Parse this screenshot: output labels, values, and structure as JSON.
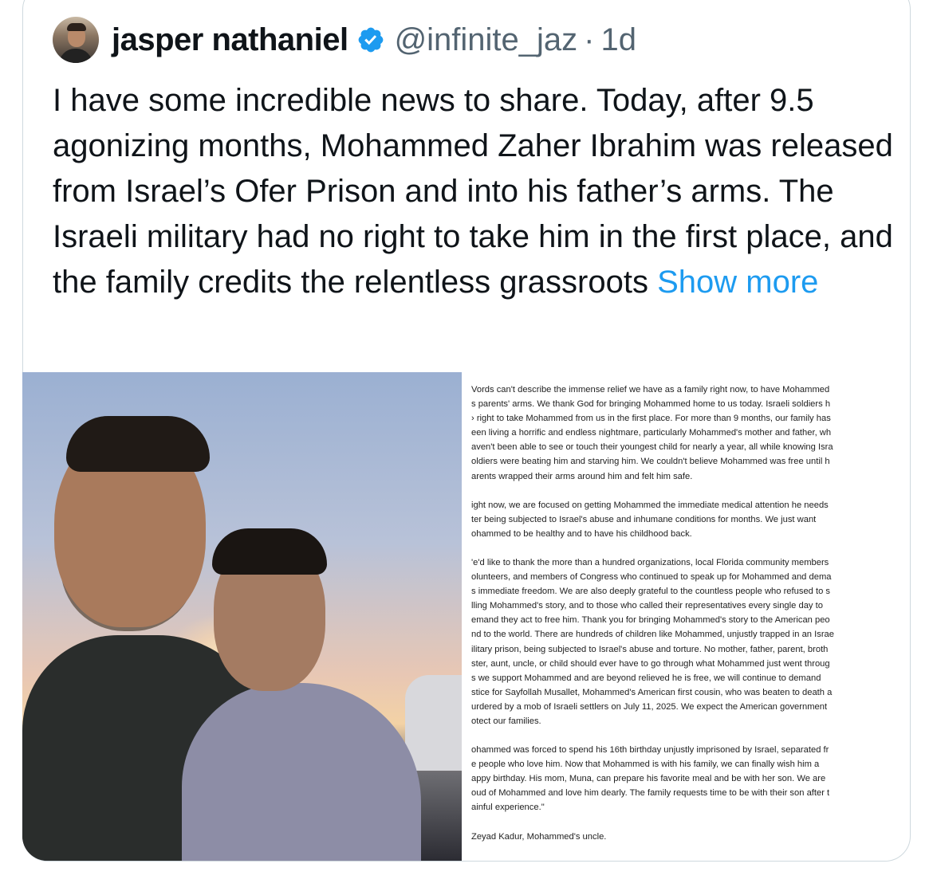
{
  "tweet": {
    "display_name": "jasper nathaniel",
    "handle": "@infinite_jaz",
    "separator": "·",
    "time": "1d",
    "text": "I have some incredible news to share. Today, after 9.5 agonizing months, Mohammed Zaher Ibrahim was released from Israel’s Ofer Prison and into his father’s arms. The Israeli military had no right to take him in the first place, and the family credits the relentless grassroots ",
    "show_more": "Show more"
  },
  "colors": {
    "accent": "#1d9bf0",
    "text": "#0f1419",
    "secondary": "#536471",
    "border": "#cfd9de"
  },
  "icons": {
    "verified": "verified-badge-icon"
  },
  "letter": {
    "paragraphs": [
      [
        "Vords can't describe the immense relief we have as a family right now, to have Mohammed",
        "s parents' arms. We thank God for bringing Mohammed home to us today. Israeli soldiers h",
        "› right to take Mohammed from us in the first place. For more than 9 months, our family has",
        "een living a horrific and endless nightmare, particularly Mohammed's mother and father, wh",
        "aven't been able to see or touch their youngest child for nearly a year, all while knowing Isra",
        "oldiers were beating him and starving him.  We couldn't believe Mohammed was free until h",
        "arents wrapped their arms around him and felt him safe."
      ],
      [
        "ight now, we are focused on getting Mohammed the immediate medical attention he needs",
        "ter being subjected to Israel's abuse and inhumane conditions for months. We just want",
        "ohammed to be healthy and to have his childhood back."
      ],
      [
        "'e'd like to thank the more than a hundred organizations, local Florida community members",
        "olunteers, and members of Congress who continued to speak up for Mohammed and dema",
        "s immediate freedom. We are also deeply grateful to the countless people who refused to s",
        "lling Mohammed's story, and to those who called their representatives every single day to",
        "emand they act to free him. Thank you for bringing Mohammed's story to the American peo",
        "nd to the world. There are hundreds of children like Mohammed, unjustly trapped in an Israe",
        "ilitary prison, being subjected to Israel's abuse and torture. No mother, father, parent, broth",
        "ster, aunt, uncle, or child should ever have to go through what Mohammed just went throug",
        "s we support Mohammed and are beyond relieved he is free, we will continue to demand",
        "stice for Sayfollah Musallet, Mohammed's American first cousin, who was beaten to death a",
        "urdered by a mob of Israeli settlers on July 11, 2025. We expect the American government",
        "otect our families."
      ],
      [
        "ohammed was forced to spend his 16th birthday unjustly imprisoned by Israel, separated fr",
        "e people who love him. Now that Mohammed is with his family, we can finally wish him a",
        "appy birthday. His mom, Muna, can prepare his favorite meal and be with her son. We are",
        "oud of Mohammed and love him dearly. The family requests time to be with their son after t",
        "ainful experience.\""
      ],
      [
        "Zeyad Kadur, Mohammed's uncle."
      ]
    ]
  }
}
